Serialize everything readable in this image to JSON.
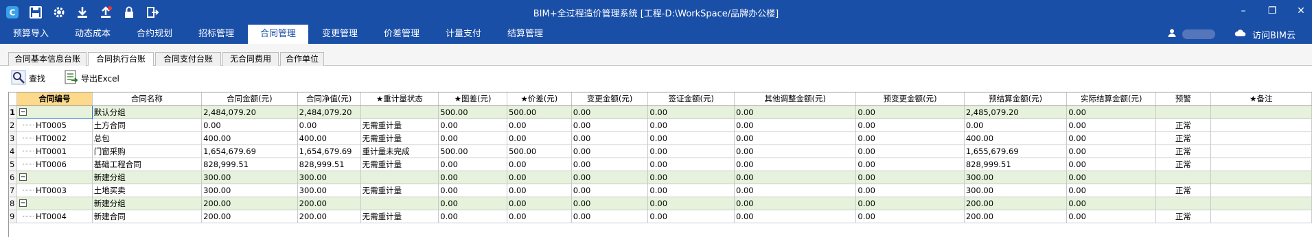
{
  "window": {
    "title": "BIM+全过程造价管理系统 [工程-D:\\WorkSpace/品牌办公楼]",
    "toolbar_icons": [
      "app-logo-icon",
      "save-icon",
      "settings-icon",
      "download-icon",
      "upload-icon",
      "lock-icon",
      "exit-icon"
    ],
    "controls": [
      "minimize",
      "restore",
      "close"
    ]
  },
  "menu": {
    "items": [
      "预算导入",
      "动态成本",
      "合约规划",
      "招标管理",
      "合同管理",
      "变更管理",
      "价差管理",
      "计量支付",
      "结算管理"
    ],
    "active_index": 4,
    "visit_bim_cloud": "访问BIM云"
  },
  "subtabs": {
    "items": [
      "合同基本信息台账",
      "合同执行台账",
      "合同支付台账",
      "无合同费用",
      "合作单位"
    ],
    "active_index": 1
  },
  "toolbar": {
    "find": "查找",
    "export_excel": "导出Excel"
  },
  "table": {
    "headers": [
      "合同编号",
      "合同名称",
      "合同金额(元)",
      "合同净值(元)",
      "★重计量状态",
      "★图差(元)",
      "★价差(元)",
      "变更金额(元)",
      "签证金额(元)",
      "其他调整金额(元)",
      "预变更金额(元)",
      "预结算金额(元)",
      "实际结算金额(元)",
      "预警",
      "★备注"
    ],
    "rows": [
      {
        "num": "1",
        "group": true,
        "cells": [
          "",
          "默认分组",
          "2,484,079.20",
          "2,484,079.20",
          "",
          "500.00",
          "500.00",
          "0.00",
          "0.00",
          "0.00",
          "0.00",
          "2,485,079.20",
          "0.00",
          "",
          ""
        ]
      },
      {
        "num": "2",
        "group": false,
        "cells": [
          "HT0005",
          "土方合同",
          "0.00",
          "0.00",
          "无需重计量",
          "0.00",
          "0.00",
          "0.00",
          "0.00",
          "0.00",
          "0.00",
          "0.00",
          "0.00",
          "正常",
          ""
        ]
      },
      {
        "num": "3",
        "group": false,
        "cells": [
          "HT0002",
          "总包",
          "400.00",
          "400.00",
          "无需重计量",
          "0.00",
          "0.00",
          "0.00",
          "0.00",
          "0.00",
          "0.00",
          "400.00",
          "0.00",
          "正常",
          ""
        ]
      },
      {
        "num": "4",
        "group": false,
        "cells": [
          "HT0001",
          "门窗采购",
          "1,654,679.69",
          "1,654,679.69",
          "重计量未完成",
          "500.00",
          "500.00",
          "0.00",
          "0.00",
          "0.00",
          "0.00",
          "1,655,679.69",
          "0.00",
          "正常",
          ""
        ]
      },
      {
        "num": "5",
        "group": false,
        "cells": [
          "HT0006",
          "基础工程合同",
          "828,999.51",
          "828,999.51",
          "无需重计量",
          "0.00",
          "0.00",
          "0.00",
          "0.00",
          "0.00",
          "0.00",
          "828,999.51",
          "0.00",
          "正常",
          ""
        ]
      },
      {
        "num": "6",
        "group": true,
        "cells": [
          "",
          "新建分组",
          "300.00",
          "300.00",
          "",
          "0.00",
          "0.00",
          "0.00",
          "0.00",
          "0.00",
          "0.00",
          "300.00",
          "0.00",
          "",
          ""
        ]
      },
      {
        "num": "7",
        "group": false,
        "cells": [
          "HT0003",
          "土地买卖",
          "300.00",
          "300.00",
          "无需重计量",
          "0.00",
          "0.00",
          "0.00",
          "0.00",
          "0.00",
          "0.00",
          "300.00",
          "0.00",
          "正常",
          ""
        ]
      },
      {
        "num": "8",
        "group": true,
        "cells": [
          "",
          "新建分组",
          "200.00",
          "200.00",
          "",
          "0.00",
          "0.00",
          "0.00",
          "0.00",
          "0.00",
          "0.00",
          "200.00",
          "0.00",
          "",
          ""
        ]
      },
      {
        "num": "9",
        "group": false,
        "cells": [
          "HT0004",
          "新建合同",
          "200.00",
          "200.00",
          "无需重计量",
          "0.00",
          "0.00",
          "0.00",
          "0.00",
          "0.00",
          "0.00",
          "200.00",
          "0.00",
          "正常",
          ""
        ]
      }
    ]
  }
}
